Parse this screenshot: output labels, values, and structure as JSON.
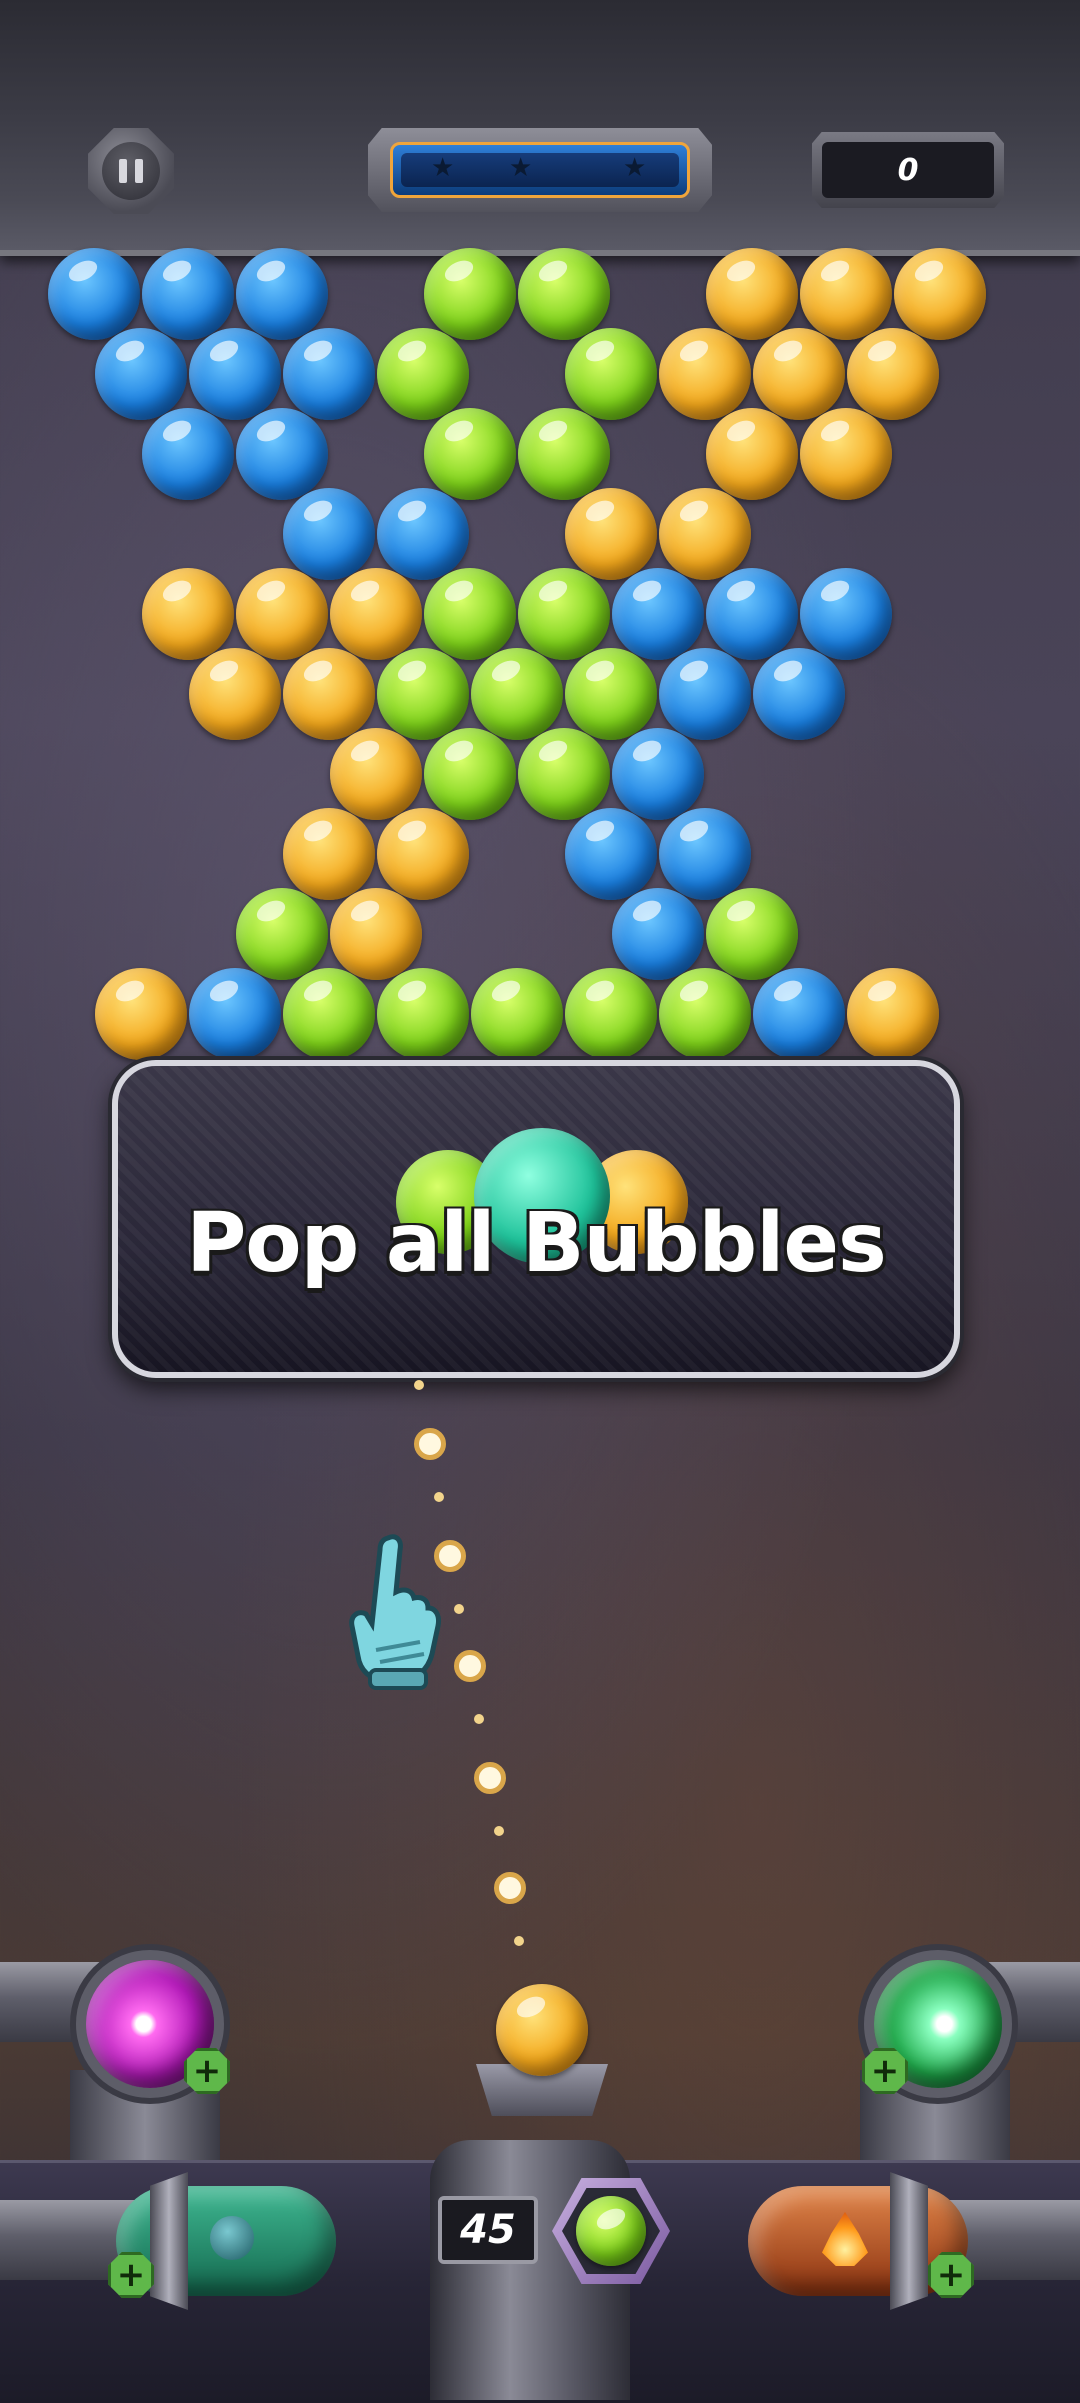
{
  "hud": {
    "pause_label": "Pause",
    "score": "0",
    "stars_earned": 0,
    "stars_total": 3
  },
  "board": {
    "colors": {
      "blue": "#1a7fe0",
      "green": "#7ed21a",
      "yellow": "#f3a81c"
    },
    "rows": [
      [
        "blue",
        "blue",
        "blue",
        null,
        "green",
        "green",
        null,
        "yellow",
        "yellow",
        "yellow"
      ],
      [
        "blue",
        "blue",
        "blue",
        "green",
        null,
        "green",
        "yellow",
        "yellow",
        "yellow"
      ],
      [
        null,
        "blue",
        "blue",
        null,
        "green",
        "green",
        null,
        "yellow",
        "yellow",
        null
      ],
      [
        null,
        null,
        "blue",
        "blue",
        null,
        "yellow",
        "yellow",
        null,
        null
      ],
      [
        null,
        "yellow",
        "yellow",
        "yellow",
        "green",
        "green",
        "blue",
        "blue",
        "blue",
        null
      ],
      [
        null,
        "yellow",
        "yellow",
        "green",
        "green",
        "green",
        "blue",
        "blue",
        null
      ],
      [
        null,
        null,
        null,
        "yellow",
        "green",
        "green",
        "blue",
        null,
        null,
        null
      ],
      [
        null,
        null,
        "yellow",
        "yellow",
        null,
        "blue",
        "blue",
        null,
        null
      ],
      [
        null,
        null,
        "green",
        "yellow",
        null,
        null,
        "blue",
        "green",
        null,
        null
      ],
      [
        "yellow",
        "blue",
        "green",
        "green",
        "green",
        "green",
        "green",
        "blue",
        "yellow"
      ]
    ]
  },
  "banner": {
    "title": "Pop all Bubbles"
  },
  "launcher": {
    "current_bubble": "yellow",
    "next_bubble": "green",
    "shots_left": "45"
  },
  "boosters": {
    "top_left": {
      "name": "laser-booster",
      "color": "#d02ad0",
      "add_label": "+"
    },
    "top_right": {
      "name": "spark-booster",
      "color": "#1fa84a",
      "add_label": "+"
    },
    "bottom_left": {
      "name": "bubble-capsule-booster",
      "color": "#1f8a6a",
      "add_label": "+"
    },
    "bottom_right": {
      "name": "fire-capsule-booster",
      "color": "#c0501a",
      "add_label": "+"
    }
  }
}
